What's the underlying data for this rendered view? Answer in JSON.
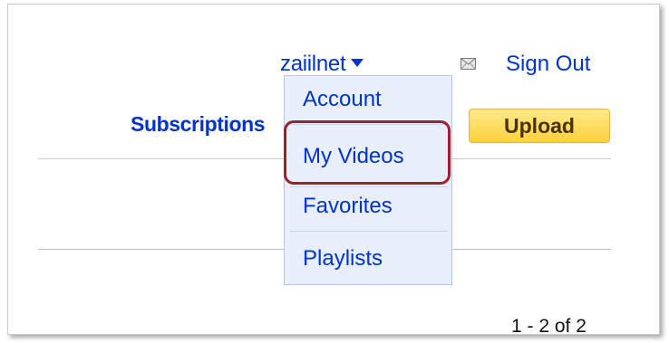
{
  "header": {
    "username": "zaiilnet",
    "sign_out": "Sign Out",
    "mail_icon": "envelope-icon"
  },
  "nav": {
    "subscriptions": "Subscriptions",
    "upload": "Upload"
  },
  "user_menu": {
    "items": [
      {
        "label": "Account"
      },
      {
        "label": "My Videos",
        "highlighted": true
      },
      {
        "label": "Favorites"
      },
      {
        "label": "Playlists"
      }
    ]
  },
  "pagination": {
    "text": "1 - 2 of 2"
  },
  "colors": {
    "link": "#0033cc",
    "highlight": "#a0202c",
    "menu_bg": "#e8eefb",
    "upload_button": "#fdd13c"
  }
}
